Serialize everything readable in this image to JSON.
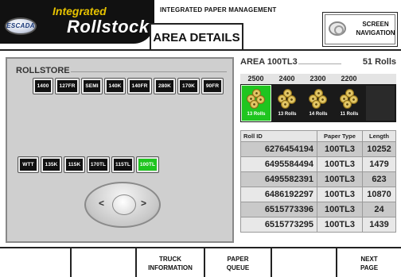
{
  "header": {
    "logo_oval": "ESCADA",
    "brand_line1": "Integrated",
    "brand_line2": "Rollstock",
    "app_title": "INTEGRATED PAPER MANAGEMENT",
    "tab_title": "AREA DETAILS",
    "screen_nav": {
      "line1": "SCREEN",
      "line2": "NAVIGATION",
      "icon": "disc-icon"
    }
  },
  "rollstore": {
    "title": "ROLLSTORE",
    "top_areas": [
      "1400",
      "127FR",
      "SEMI",
      "140K",
      "140FR",
      "280K",
      "170K",
      "90FR"
    ],
    "bottom_areas": [
      "WTT",
      "135K",
      "115K",
      "170TL",
      "115TL",
      "100TL"
    ],
    "selected_area": "100TL",
    "selected_color": "#1fc51f"
  },
  "area": {
    "name": "AREA 100TL3",
    "roll_count": "51 Rolls",
    "lanes": [
      {
        "label": "2500",
        "rolls": "13 Rolls",
        "active": true
      },
      {
        "label": "2400",
        "rolls": "13 Rolls",
        "active": false
      },
      {
        "label": "2300",
        "rolls": "14 Rolls",
        "active": false
      },
      {
        "label": "2200",
        "rolls": "11 Rolls",
        "active": false
      }
    ]
  },
  "table": {
    "headers": [
      "Roll ID",
      "Paper Type",
      "Length"
    ],
    "rows": [
      [
        "6276454194",
        "100TL3",
        "10252"
      ],
      [
        "6495584494",
        "100TL3",
        "1479"
      ],
      [
        "6495582391",
        "100TL3",
        "623"
      ],
      [
        "6486192297",
        "100TL3",
        "10870"
      ],
      [
        "6515773396",
        "100TL3",
        "24"
      ],
      [
        "6515773295",
        "100TL3",
        "1439"
      ]
    ]
  },
  "nav": {
    "left": "<",
    "right": ">"
  },
  "footer": {
    "buttons": [
      {
        "line1": "",
        "line2": ""
      },
      {
        "line1": "",
        "line2": ""
      },
      {
        "line1": "TRUCK",
        "line2": "INFORMATION"
      },
      {
        "line1": "PAPER",
        "line2": "QUEUE"
      },
      {
        "line1": "",
        "line2": ""
      },
      {
        "line1": "NEXT",
        "line2": "PAGE"
      }
    ]
  }
}
